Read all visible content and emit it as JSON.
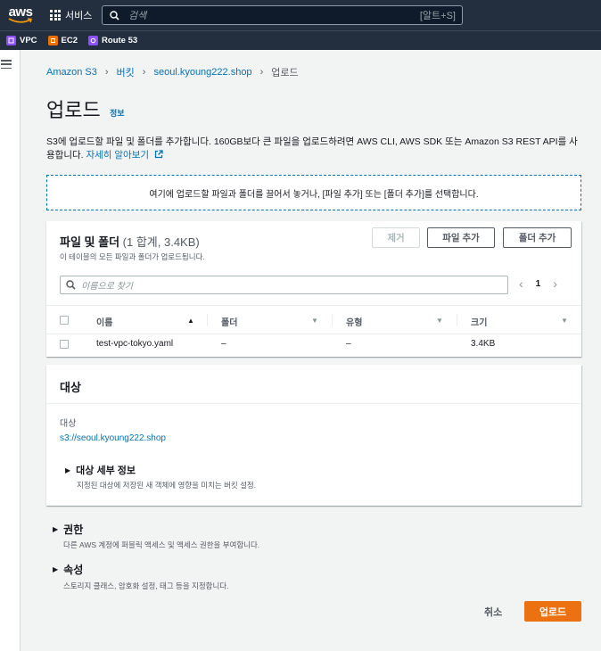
{
  "topnav": {
    "logo": "aws",
    "services_label": "서비스",
    "search_placeholder": "검색",
    "search_shortcut": "[알트+S]"
  },
  "favorites": [
    {
      "label": "VPC",
      "icon": "vpc-icon",
      "color": "#8c4fff"
    },
    {
      "label": "EC2",
      "icon": "ec2-icon",
      "color": "#ed7100"
    },
    {
      "label": "Route 53",
      "icon": "route53-icon",
      "color": "#8c4fff"
    }
  ],
  "breadcrumb": {
    "items": [
      "Amazon S3",
      "버킷",
      "seoul.kyoung222.shop"
    ],
    "current": "업로드"
  },
  "page": {
    "title": "업로드",
    "info": "정보",
    "description": "S3에 업로드할 파일 및 폴더를 추가합니다. 160GB보다 큰 파일을 업로드하려면 AWS CLI, AWS SDK 또는 Amazon S3 REST API를 사용합니다.",
    "learn_more": "자세히 알아보기",
    "dropzone": "여기에 업로드할 파일과 폴더를 끌어서 놓거나, [파일 추가] 또는 [폴더 추가]를 선택합니다."
  },
  "files": {
    "title": "파일 및 폴더",
    "count": "(1 합계, 3.4KB)",
    "subtitle": "이 테이블의 모든 파일과 폴더가 업로드됩니다.",
    "remove_label": "제거",
    "add_files_label": "파일 추가",
    "add_folder_label": "폴더 추가",
    "search_placeholder": "이름으로 찾기",
    "page_number": "1",
    "columns": [
      "이름",
      "폴더",
      "유형",
      "크기"
    ],
    "rows": [
      {
        "name": "test-vpc-tokyo.yaml",
        "folder": "–",
        "type": "–",
        "size": "3.4KB"
      }
    ]
  },
  "target": {
    "title": "대상",
    "label": "대상",
    "value": "s3://seoul.kyoung222.shop",
    "details_title": "대상 세부 정보",
    "details_desc": "지정된 대상에 저장된 새 객체에 영향을 미치는 버킷 설정."
  },
  "permissions": {
    "title": "권한",
    "desc": "다른 AWS 계정에 퍼블릭 액세스 및 액세스 권한을 부여합니다."
  },
  "properties": {
    "title": "속성",
    "desc": "스토리지 클래스, 암호화 설정, 태그 등을 지정합니다."
  },
  "actions": {
    "cancel": "취소",
    "upload": "업로드"
  }
}
